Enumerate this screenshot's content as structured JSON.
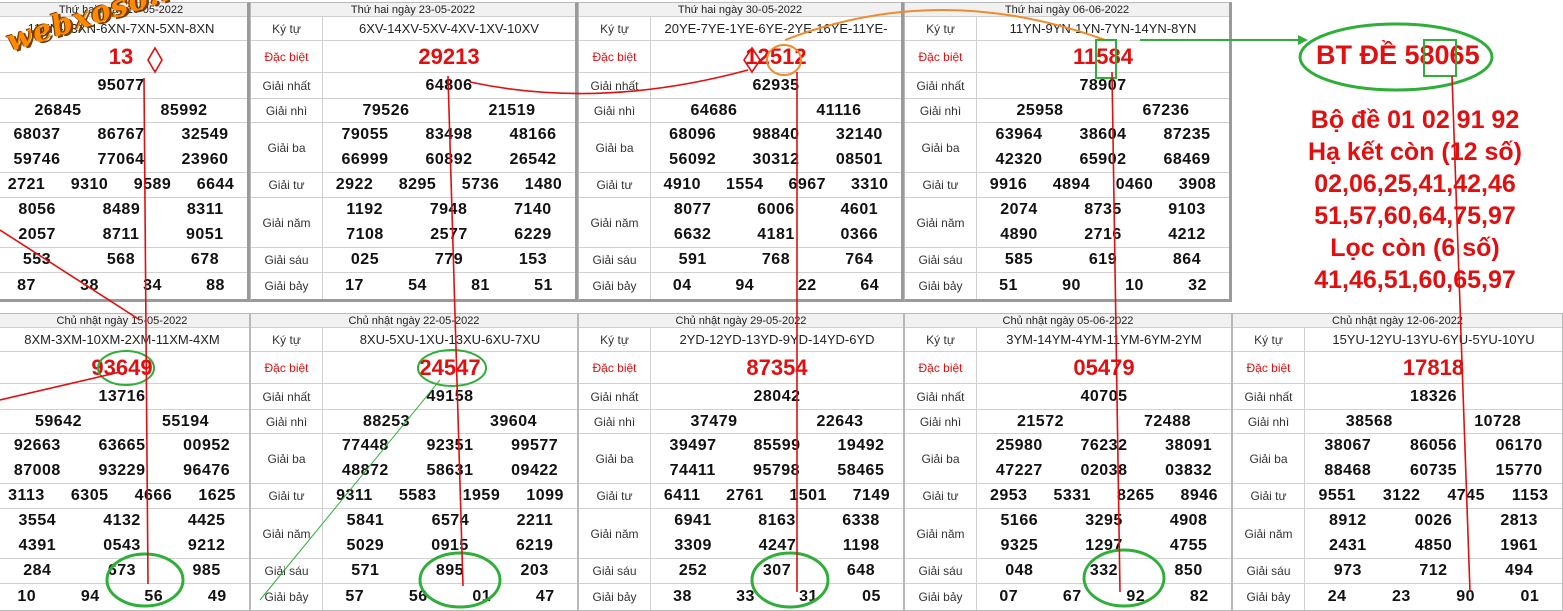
{
  "watermark": "webxoso.net",
  "labels": {
    "code": "Ký tự",
    "db": "Đặc biệt",
    "g1": "Giải nhất",
    "g2": "Giải nhì",
    "g3": "Giải ba",
    "g4": "Giải tư",
    "g5": "Giải năm",
    "g6": "Giải sáu",
    "g7": "Giải bảy"
  },
  "top": [
    {
      "header": "Thứ hai ngày 16-05-2022",
      "code": "11XN-13XN-6XN-7XN-5XN-8XN",
      "db": "13",
      "g1": "95077",
      "g2": [
        "26845",
        "85992"
      ],
      "g3": [
        [
          "68037",
          "86767",
          "32549"
        ],
        [
          "59746",
          "77064",
          "23960"
        ]
      ],
      "g4": [
        "2721",
        "9310",
        "9589",
        "6644"
      ],
      "g5": [
        [
          "8056",
          "8489",
          "8311"
        ],
        [
          "2057",
          "8711",
          "9051"
        ]
      ],
      "g6": [
        "553",
        "568",
        "678"
      ],
      "g7": [
        "87",
        "38",
        "34",
        "88"
      ]
    },
    {
      "header": "Thứ hai ngày 23-05-2022",
      "code": "6XV-14XV-5XV-4XV-1XV-10XV",
      "db": "29213",
      "g1": "64806",
      "g2": [
        "79526",
        "21519"
      ],
      "g3": [
        [
          "79055",
          "83498",
          "48166"
        ],
        [
          "66999",
          "60892",
          "26542"
        ]
      ],
      "g4": [
        "2922",
        "8295",
        "5736",
        "1480"
      ],
      "g5": [
        [
          "1192",
          "7948",
          "7140"
        ],
        [
          "7108",
          "2577",
          "6229"
        ]
      ],
      "g6": [
        "025",
        "779",
        "153"
      ],
      "g7": [
        "17",
        "54",
        "81",
        "51"
      ]
    },
    {
      "header": "Thứ hai ngày 30-05-2022",
      "code": "20YE-7YE-1YE-6YE-2YE-16YE-11YE-",
      "db": "12512",
      "g1": "62935",
      "g2": [
        "64686",
        "41116"
      ],
      "g3": [
        [
          "68096",
          "98840",
          "32140"
        ],
        [
          "56092",
          "30312",
          "08501"
        ]
      ],
      "g4": [
        "4910",
        "1554",
        "6967",
        "3310"
      ],
      "g5": [
        [
          "8077",
          "6006",
          "4601"
        ],
        [
          "6632",
          "4181",
          "0366"
        ]
      ],
      "g6": [
        "591",
        "768",
        "764"
      ],
      "g7": [
        "04",
        "94",
        "22",
        "64"
      ]
    },
    {
      "header": "Thứ hai ngày 06-06-2022",
      "code": "11YN-9YN-1YN-7YN-14YN-8YN",
      "db": "11584",
      "g1": "78907",
      "g2": [
        "25958",
        "67236"
      ],
      "g3": [
        [
          "63964",
          "38604",
          "87235"
        ],
        [
          "42320",
          "65902",
          "68469"
        ]
      ],
      "g4": [
        "9916",
        "4894",
        "0460",
        "3908"
      ],
      "g5": [
        [
          "2074",
          "8735",
          "9103"
        ],
        [
          "4890",
          "2716",
          "4212"
        ]
      ],
      "g6": [
        "585",
        "619",
        "864"
      ],
      "g7": [
        "51",
        "90",
        "10",
        "32"
      ]
    }
  ],
  "bottom": [
    {
      "header": "Chủ nhật ngày 15-05-2022",
      "code": "8XM-3XM-10XM-2XM-11XM-4XM",
      "db": "93649",
      "g1": "13716",
      "g2": [
        "59642",
        "55194"
      ],
      "g3": [
        [
          "92663",
          "63665",
          "00952"
        ],
        [
          "87008",
          "93229",
          "96476"
        ]
      ],
      "g4": [
        "3113",
        "6305",
        "4666",
        "1625"
      ],
      "g5": [
        [
          "3554",
          "4132",
          "4425"
        ],
        [
          "4391",
          "0543",
          "9212"
        ]
      ],
      "g6": [
        "284",
        "673",
        "985"
      ],
      "g7": [
        "10",
        "94",
        "56",
        "49"
      ]
    },
    {
      "header": "Chủ nhật ngày 22-05-2022",
      "code": "8XU-5XU-1XU-13XU-6XU-7XU",
      "db": "24547",
      "g1": "49158",
      "g2": [
        "88253",
        "39604"
      ],
      "g3": [
        [
          "77448",
          "92351",
          "99577"
        ],
        [
          "48872",
          "58631",
          "09422"
        ]
      ],
      "g4": [
        "9311",
        "5583",
        "1959",
        "1099"
      ],
      "g5": [
        [
          "5841",
          "6574",
          "2211"
        ],
        [
          "5029",
          "0915",
          "6219"
        ]
      ],
      "g6": [
        "571",
        "895",
        "203"
      ],
      "g7": [
        "57",
        "56",
        "01",
        "47"
      ]
    },
    {
      "header": "Chủ nhật ngày 29-05-2022",
      "code": "2YD-12YD-13YD-9YD-14YD-6YD",
      "db": "87354",
      "g1": "28042",
      "g2": [
        "37479",
        "22643"
      ],
      "g3": [
        [
          "39497",
          "85599",
          "19492"
        ],
        [
          "74411",
          "95798",
          "58465"
        ]
      ],
      "g4": [
        "6411",
        "2761",
        "1501",
        "7149"
      ],
      "g5": [
        [
          "6941",
          "8163",
          "6338"
        ],
        [
          "3309",
          "4247",
          "1198"
        ]
      ],
      "g6": [
        "252",
        "307",
        "648"
      ],
      "g7": [
        "38",
        "33",
        "31",
        "05"
      ]
    },
    {
      "header": "Chủ nhật ngày 05-06-2022",
      "code": "3YM-14YM-4YM-11YM-6YM-2YM",
      "db": "05479",
      "g1": "40705",
      "g2": [
        "21572",
        "72488"
      ],
      "g3": [
        [
          "25980",
          "76232",
          "38091"
        ],
        [
          "47227",
          "02038",
          "03832"
        ]
      ],
      "g4": [
        "2953",
        "5331",
        "8265",
        "8946"
      ],
      "g5": [
        [
          "5166",
          "3295",
          "4908"
        ],
        [
          "9325",
          "1297",
          "4755"
        ]
      ],
      "g6": [
        "048",
        "332",
        "850"
      ],
      "g7": [
        "07",
        "67",
        "92",
        "82"
      ]
    },
    {
      "header": "Chủ nhật ngày 12-06-2022",
      "code": "15YU-12YU-13YU-6YU-5YU-10YU",
      "db": "17818",
      "g1": "18326",
      "g2": [
        "38568",
        "10728"
      ],
      "g3": [
        [
          "38067",
          "86056",
          "06170"
        ],
        [
          "88468",
          "60735",
          "15770"
        ]
      ],
      "g4": [
        "9551",
        "3122",
        "4745",
        "1153"
      ],
      "g5": [
        [
          "8912",
          "0026",
          "2813"
        ],
        [
          "2431",
          "4850",
          "1961"
        ]
      ],
      "g6": [
        "973",
        "712",
        "494"
      ],
      "g7": [
        "24",
        "23",
        "90",
        "01"
      ]
    }
  ],
  "annotation": {
    "bt": "BT ĐỀ 58065",
    "lines": [
      "Bộ đề 01 02 91 92",
      "Hạ kết còn (12 số)",
      "02,06,25,41,42,46",
      "51,57,60,64,75,97",
      "Lọc còn (6 số)",
      "41,46,51,60,65,97"
    ]
  },
  "colors": {
    "red": "#e10f0f",
    "green": "#2fae3a",
    "orange": "#f08a2a",
    "grid": "#d0d0d0"
  }
}
